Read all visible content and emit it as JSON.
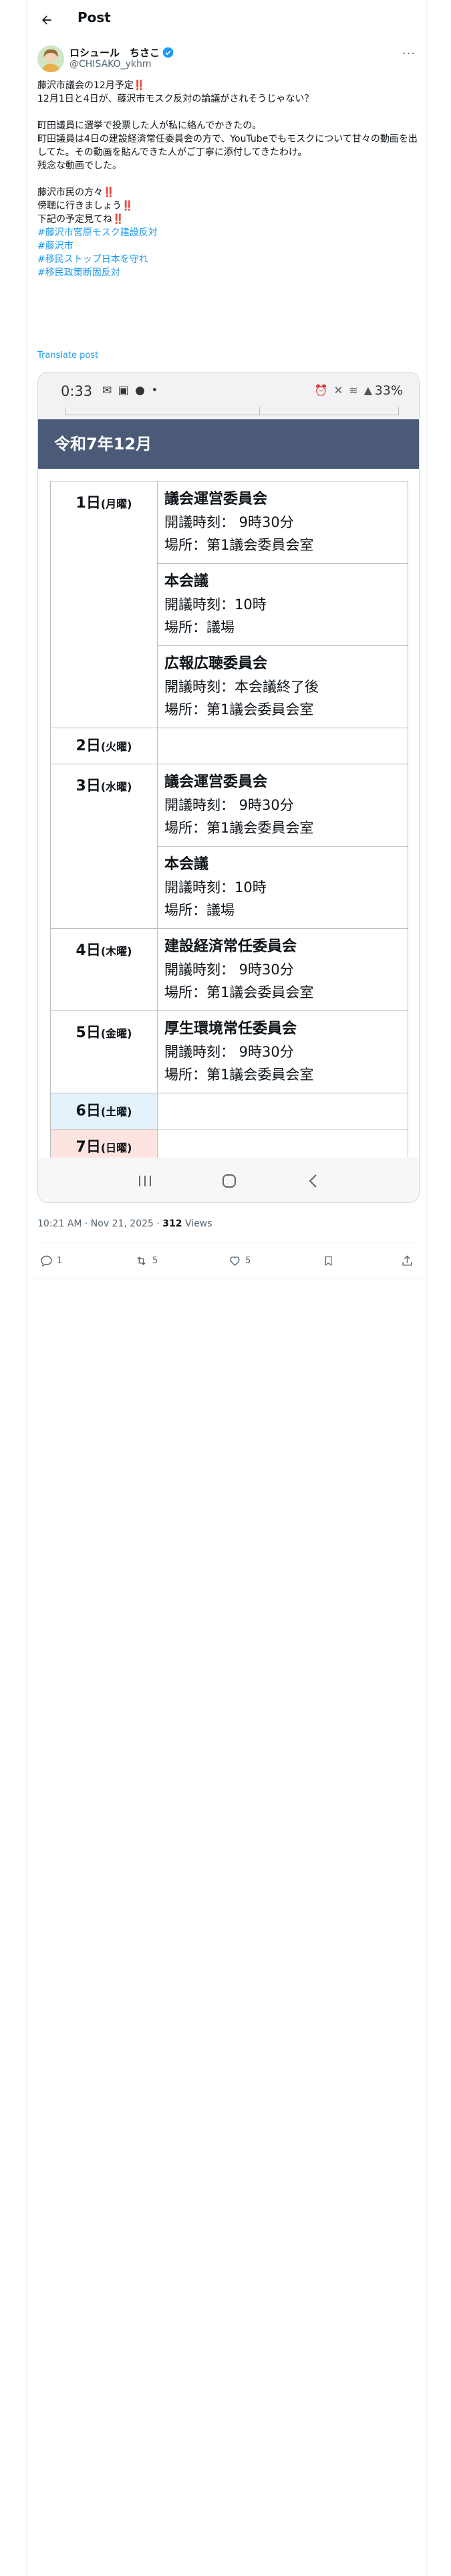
{
  "header": {
    "title": "Post"
  },
  "author": {
    "display_name": "ロシュール　ちさこ",
    "handle": "@CHISAKO_ykhm",
    "verified": true
  },
  "tweet": {
    "lines": [
      {
        "text": "藤沢市議会の12月予定‼️",
        "tag": false
      },
      {
        "text": "12月1日と4日が、藤沢市モスク反対の論議がされそうじゃない？",
        "tag": false
      },
      {
        "text": "",
        "tag": false
      },
      {
        "text": "町田議員に選挙で投票した人が私に絡んでかきたの。",
        "tag": false
      },
      {
        "text": "町田議員は4日の建設経済常任委員会の方で、YouTubeでもモスクについて甘々の動画を出してた。その動画を貼んできた人がご丁寧に添付してきたわけ。",
        "tag": false
      },
      {
        "text": "残念な動画でした。",
        "tag": false
      },
      {
        "text": "",
        "tag": false
      },
      {
        "text": "藤沢市民の方々‼️",
        "tag": false
      },
      {
        "text": "傍聴に行きましょう‼️",
        "tag": false
      },
      {
        "text": "下記の予定見てね‼️",
        "tag": false
      },
      {
        "text": "#藤沢市宮原モスク建設反対",
        "tag": true
      },
      {
        "text": "#藤沢市",
        "tag": true
      },
      {
        "text": "#移民ストップ日本を守れ",
        "tag": true
      },
      {
        "text": "#移民政策断固反対",
        "tag": true
      }
    ],
    "translate_label": "Translate post"
  },
  "media": {
    "status_time": "0:33",
    "battery": "33%",
    "banner_title": "令和7年12月",
    "schedule": [
      {
        "day": "1日",
        "weekday": "(月曜)",
        "kind": "weekday",
        "events": [
          {
            "title": "議会運営委員会",
            "time": "開議時刻：  9時30分",
            "place": "場所：第1議会委員会室"
          },
          {
            "title": "本会議",
            "time": "開議時刻：10時",
            "place": "場所：議場"
          },
          {
            "title": "広報広聴委員会",
            "time": "開議時刻：本会議終了後",
            "place": "場所：第1議会委員会室"
          }
        ]
      },
      {
        "day": "2日",
        "weekday": "(火曜)",
        "kind": "weekday",
        "events": []
      },
      {
        "day": "3日",
        "weekday": "(水曜)",
        "kind": "weekday",
        "events": [
          {
            "title": "議会運営委員会",
            "time": "開議時刻：  9時30分",
            "place": "場所：第1議会委員会室"
          },
          {
            "title": "本会議",
            "time": "開議時刻：10時",
            "place": "場所：議場"
          }
        ]
      },
      {
        "day": "4日",
        "weekday": "(木曜)",
        "kind": "weekday",
        "events": [
          {
            "title": "建設経済常任委員会",
            "time": "開議時刻：  9時30分",
            "place": "場所：第1議会委員会室"
          }
        ]
      },
      {
        "day": "5日",
        "weekday": "(金曜)",
        "kind": "weekday",
        "events": [
          {
            "title": "厚生環境常任委員会",
            "time": "開議時刻：  9時30分",
            "place": "場所：第1議会委員会室"
          }
        ]
      },
      {
        "day": "6日",
        "weekday": "(土曜)",
        "kind": "sat",
        "events": []
      },
      {
        "day": "7日",
        "weekday": "(日曜)",
        "kind": "sun",
        "events": []
      }
    ]
  },
  "meta": {
    "time": "10:21 AM · Nov 21, 2025 · ",
    "views_count": "312",
    "views_label": " Views"
  },
  "actions": {
    "replies": "1",
    "reposts": "5",
    "likes": "5"
  },
  "colors": {
    "accent": "#1d9bf0",
    "banner": "#4a5a77",
    "verified": "#1d9bf0"
  }
}
